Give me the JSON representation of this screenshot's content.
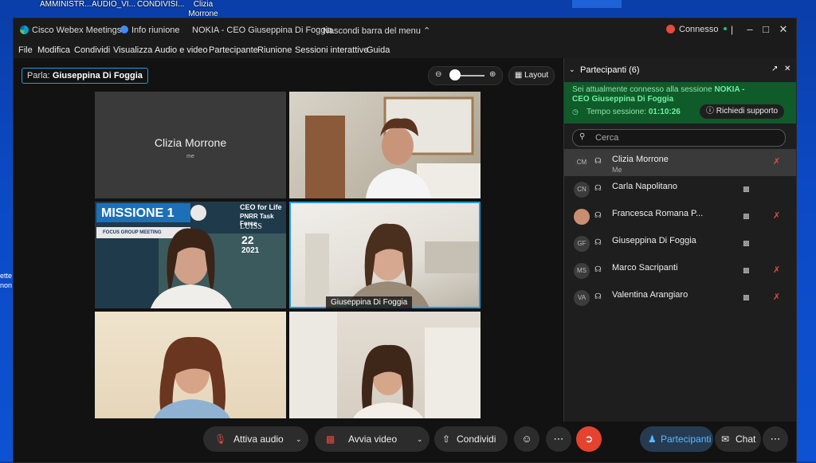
{
  "desktop": {
    "icons": [
      "AMMINISTR...",
      "AUDIO_VI...",
      "CONDIVISI...",
      "Clizia Morrone"
    ],
    "left_text": "ette non"
  },
  "window": {
    "app_name": "Cisco Webex Meetings",
    "info": "Info riunione",
    "meeting_title": "NOKIA - CEO Giuseppina Di Foggia",
    "hide_menu": "Nascondi barra del menu",
    "status": "Connesso",
    "status_color": "#2dbf6b"
  },
  "menu": [
    "File",
    "Modifica",
    "Condividi",
    "Visualizza",
    "Audio e video",
    "Partecipante",
    "Riunione",
    "Sessioni interattive",
    "Guida"
  ],
  "toolbar": {
    "speaking_label": "Parla:",
    "speaking_name": "Giuseppina Di Foggia",
    "layout_label": "Layout"
  },
  "tiles": [
    {
      "name": "Clizia Morrone",
      "sub": "me"
    },
    {
      "name": ""
    },
    {
      "banner_title": "MISSIONE 1",
      "banner_sub": "FOCUS GROUP MEETING",
      "logo_ceo": "CEO for Life",
      "logo_pnrr": "PNRR Task Force",
      "logo_luiss": "LUISS",
      "date_day": "22",
      "date_year": "2021"
    },
    {
      "name": "Giuseppina Di Foggia"
    },
    {
      "name": ""
    },
    {
      "name": ""
    }
  ],
  "controls": {
    "audio": "Attiva audio",
    "video": "Avvia video",
    "share": "Condividi",
    "participants": "Partecipanti",
    "chat": "Chat"
  },
  "panel": {
    "title": "Partecipanti (6)",
    "session_text": "Sei attualmente connesso alla sessione",
    "session_name": "NOKIA - CEO Giuseppina Di Foggia",
    "time_label": "Tempo sessione:",
    "time_value": "01:10:26",
    "support": "Richiedi supporto",
    "search_placeholder": "Cerca",
    "participants": [
      {
        "initials": "CM",
        "name": "Clizia Morrone",
        "sub": "Me",
        "cam": false,
        "muted": true
      },
      {
        "initials": "CN",
        "name": "Carla Napolitano",
        "sub": "",
        "cam": true,
        "muted": false
      },
      {
        "initials": "",
        "name": "Francesca Romana P...",
        "sub": "",
        "cam": true,
        "muted": true
      },
      {
        "initials": "GF",
        "name": "Giuseppina Di Foggia",
        "sub": "",
        "cam": true,
        "muted": false
      },
      {
        "initials": "MS",
        "name": "Marco Sacripanti",
        "sub": "",
        "cam": true,
        "muted": true
      },
      {
        "initials": "VA",
        "name": "Valentina Arangiaro",
        "sub": "",
        "cam": true,
        "muted": true
      }
    ]
  }
}
